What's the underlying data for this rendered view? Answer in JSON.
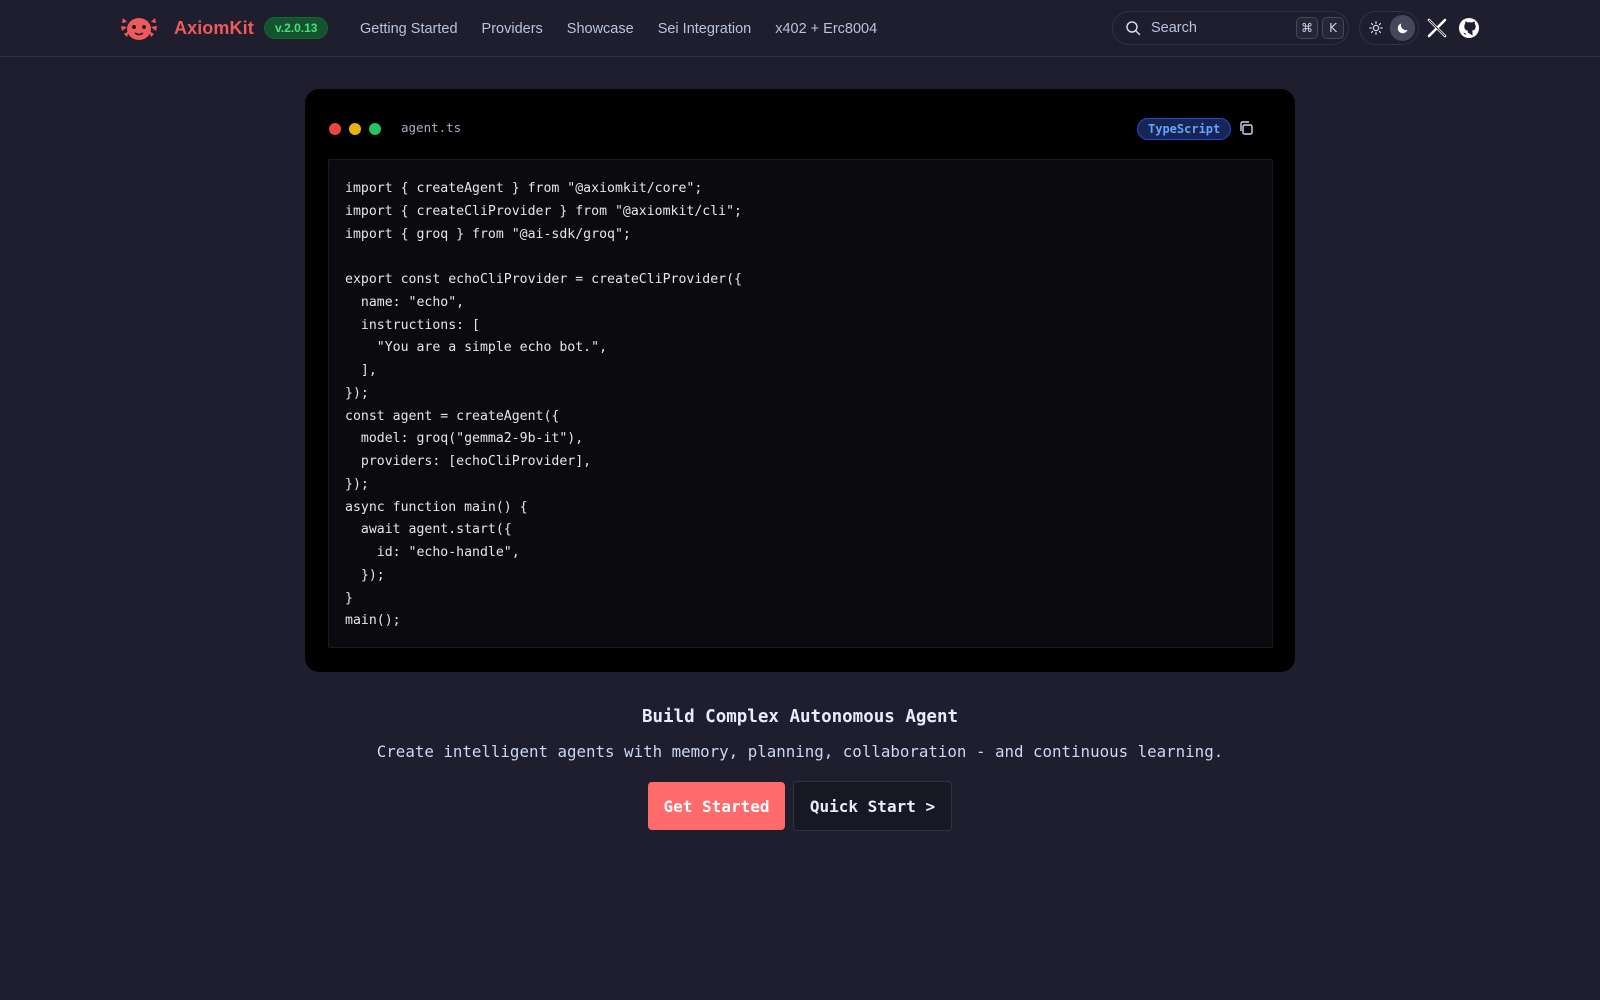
{
  "brand": {
    "name": "AxiomKit",
    "version": "v.2.0.13",
    "logo_icon": "axolotl-logo-icon",
    "color": "#f05a5a"
  },
  "nav": {
    "links": [
      "Getting Started",
      "Providers",
      "Showcase",
      "Sei Integration",
      "x402 + Erc8004"
    ]
  },
  "search": {
    "placeholder": "Search",
    "shortcut_keys": [
      "⌘",
      "K"
    ]
  },
  "theme": {
    "options": [
      "light",
      "dark"
    ],
    "selected": "dark"
  },
  "social": [
    "x-icon",
    "github-icon"
  ],
  "code_window": {
    "file_name": "agent.ts",
    "language": "TypeScript",
    "lines": [
      "import { createAgent } from \"@axiomkit/core\";",
      "import { createCliProvider } from \"@axiomkit/cli\";",
      "import { groq } from \"@ai-sdk/groq\";",
      "",
      "export const echoCliProvider = createCliProvider({",
      "  name: \"echo\",",
      "  instructions: [",
      "    \"You are a simple echo bot.\",",
      "  ],",
      "});",
      "const agent = createAgent({",
      "  model: groq(\"gemma2-9b-it\"),",
      "  providers: [echoCliProvider],",
      "});",
      "async function main() {",
      "  await agent.start({",
      "    id: \"echo-handle\",",
      "  });",
      "}",
      "main();"
    ]
  },
  "hero": {
    "title": "Build Complex Autonomous Agent",
    "subtitle": "Create intelligent agents with memory, planning, collaboration - and continuous learning.",
    "primary_cta": "Get Started",
    "secondary_cta": "Quick Start >"
  },
  "colors": {
    "background": "#1e1e2e",
    "accent": "#ff6b6b",
    "badge_green": "#4ade80",
    "badge_blue": "#60a5fa"
  }
}
